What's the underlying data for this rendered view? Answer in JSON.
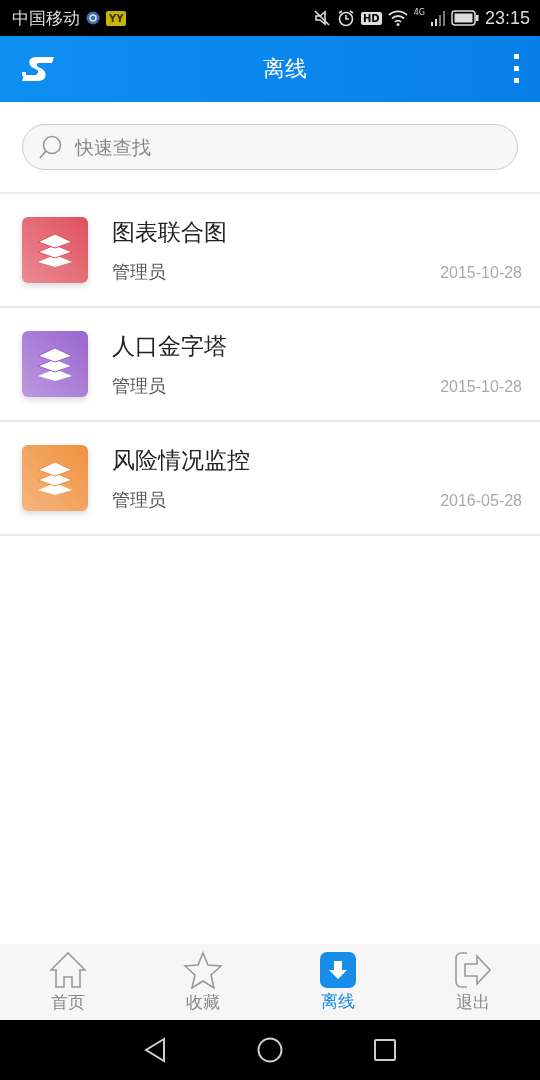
{
  "status_bar": {
    "carrier": "中国移动",
    "app_badge": "YY",
    "hd_badge": "HD",
    "network": "4G",
    "time": "23:15"
  },
  "header": {
    "title": "离线"
  },
  "search": {
    "placeholder": "快速查找"
  },
  "items": [
    {
      "title": "图表联合图",
      "owner": "管理员",
      "date": "2015-10-28",
      "color": "#e0515e"
    },
    {
      "title": "人口金字塔",
      "owner": "管理员",
      "date": "2015-10-28",
      "color": "#9a66cf"
    },
    {
      "title": "风险情况监控",
      "owner": "管理员",
      "date": "2016-05-28",
      "color": "#f0913f"
    }
  ],
  "tabs": [
    {
      "kind": "home",
      "label": "首页",
      "selected": false
    },
    {
      "kind": "star",
      "label": "收藏",
      "selected": false
    },
    {
      "kind": "download",
      "label": "离线",
      "selected": true
    },
    {
      "kind": "exit",
      "label": "退出",
      "selected": false
    }
  ]
}
